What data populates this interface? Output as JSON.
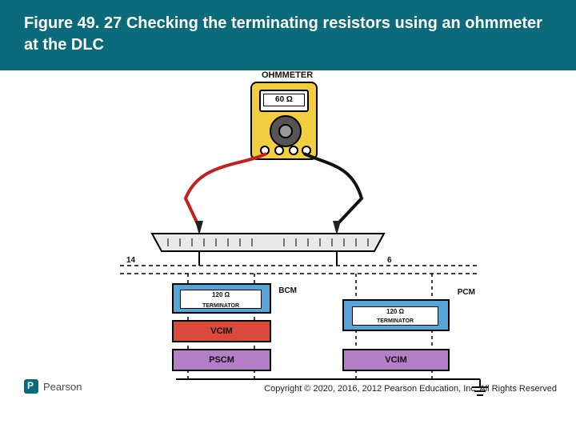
{
  "title": "Figure 49. 27 Checking the terminating resistors using an ohmmeter at the DLC",
  "ohmmeter": {
    "label": "OHMMETER",
    "reading": "60 Ω"
  },
  "dlc": {
    "pin_left": "14",
    "pin_right": "6"
  },
  "modules": {
    "bcm": {
      "label": "BCM",
      "term_label": "TERMINATOR",
      "term_value": "120 Ω"
    },
    "pcm": {
      "label": "PCM",
      "term_label": "TERMINATOR",
      "term_value": "120 Ω"
    },
    "vcim_left": {
      "label": "VCIM"
    },
    "pscm": {
      "label": "PSCM"
    },
    "vcim_right": {
      "label": "VCIM"
    }
  },
  "brand": "Pearson",
  "copyright": "Copyright © 2020, 2016, 2012 Pearson Education, Inc. All Rights Reserved",
  "chart_data": {
    "type": "table",
    "description": "Two 120 Ω terminating resistors (inside BCM and PCM) in parallel across CAN bus pins 6 and 14 of the DLC. Ohmmeter across pins 6 and 14 reads 60 Ω (parallel combination). Other modules VCIM and PSCM are on the same bus without terminators.",
    "dlc_pins_measured": [
      6,
      14
    ],
    "terminator_ohms": [
      120,
      120
    ],
    "expected_reading_ohms": 60,
    "modules_on_bus": [
      "BCM",
      "PCM",
      "VCIM",
      "PSCM",
      "VCIM"
    ]
  }
}
